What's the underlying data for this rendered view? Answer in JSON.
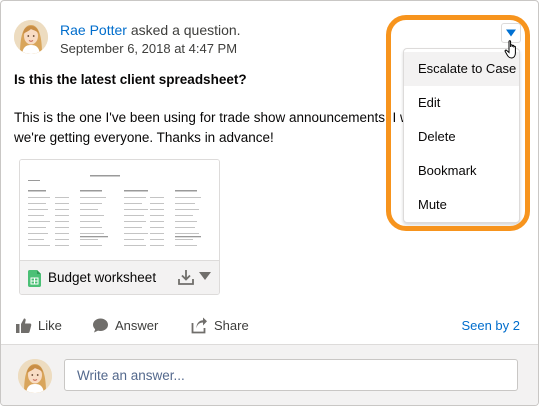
{
  "post": {
    "author": "Rae Potter",
    "action_text": " asked a question.",
    "timestamp": "September 6, 2018 at 4:47 PM",
    "question_title": "Is this the latest client spreadsheet?",
    "body_line_1": "This is the one I've been using for trade show announcements. I w",
    "body_line_2": "we're getting everyone. Thanks in advance!"
  },
  "attachment": {
    "file_name": "Budget worksheet",
    "file_icon": "spreadsheet-icon",
    "file_icon_color": "#4bc076"
  },
  "actions": {
    "like": "Like",
    "answer": "Answer",
    "share": "Share",
    "seen_by": "Seen by 2"
  },
  "answer_box": {
    "placeholder": "Write an answer..."
  },
  "menu": {
    "items": [
      "Escalate to Case",
      "Edit",
      "Delete",
      "Bookmark",
      "Mute"
    ],
    "highlight_color": "#f7941d"
  },
  "colors": {
    "link": "#006dcc",
    "text": "#3e3e3c"
  }
}
